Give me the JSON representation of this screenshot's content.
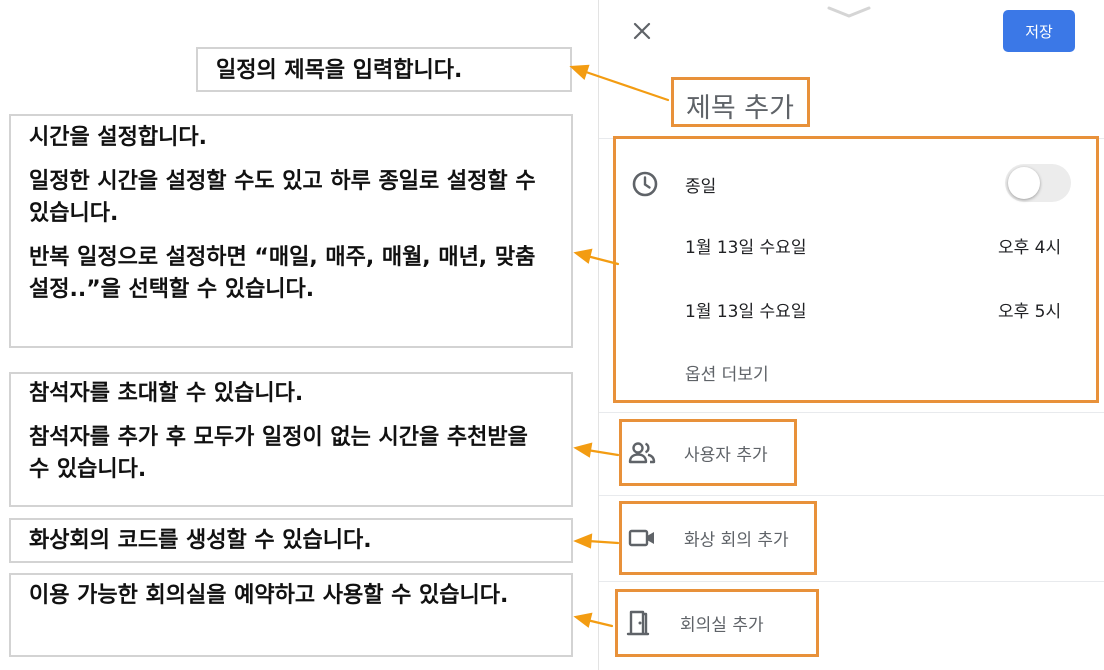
{
  "annotations": {
    "title": "일정의 제목을 입력합니다.",
    "time": [
      "시간을 설정합니다.",
      "일정한 시간을 설정할 수도 있고 하루 종일로 설정할 수 있습니다.",
      "반복 일정으로 설정하면 “매일, 매주, 매월, 매년, 맞춤 설정..”을 선택할 수 있습니다."
    ],
    "attendees": [
      "참석자를 초대할 수 있습니다.",
      "참석자를 추가 후 모두가 일정이 없는 시간을 추천받을 수 있습니다."
    ],
    "video": "화상회의 코드를 생성할 수 있습니다.",
    "room": "이용 가능한 회의실을 예약하고 사용할 수 있습니다."
  },
  "panel": {
    "save_label": "저장",
    "title_placeholder": "제목 추가",
    "all_day_label": "종일",
    "all_day_on": false,
    "start_date": "1월 13일 수요일",
    "start_time": "오후 4시",
    "end_date": "1월 13일 수요일",
    "end_time": "오후 5시",
    "more_options": "옵션 더보기",
    "add_people": "사용자 추가",
    "add_video": "화상 회의 추가",
    "add_room": "회의실 추가"
  },
  "colors": {
    "highlight": "#e8913a",
    "arrow": "#f39c12",
    "primary": "#3b78e7"
  },
  "icons": {
    "close": "close-icon",
    "handle": "chevron-down-icon",
    "clock": "clock-icon",
    "people": "people-icon",
    "video": "video-camera-icon",
    "room": "door-icon"
  }
}
